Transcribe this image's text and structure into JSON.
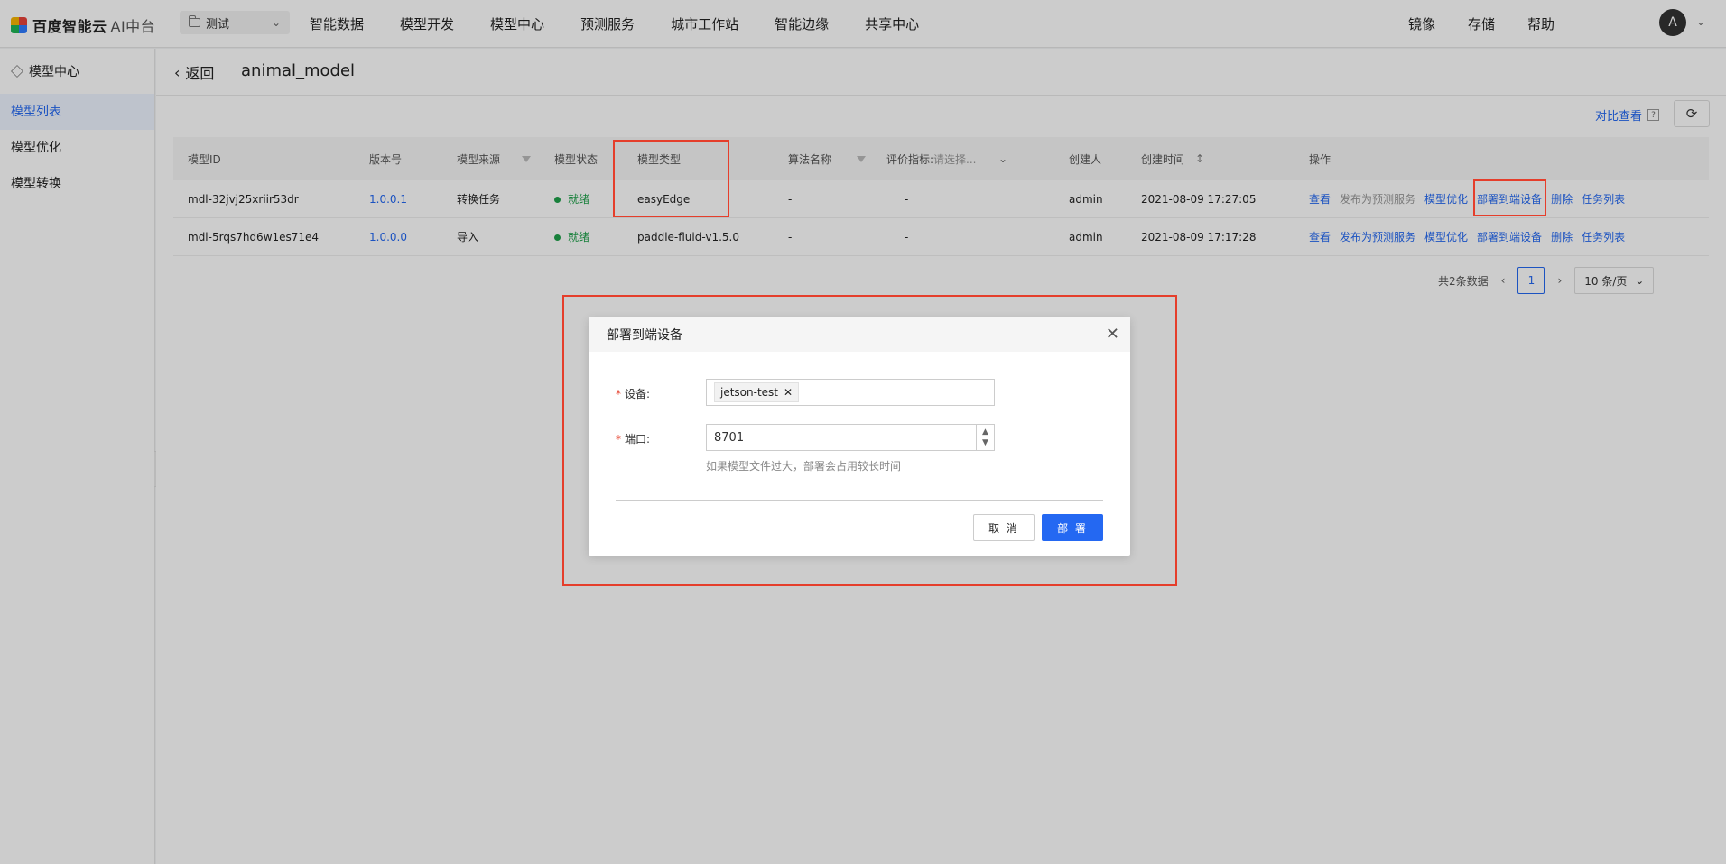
{
  "topbar": {
    "logo_text": "百度智能云",
    "logo_ai": "AI中台",
    "project": "测试",
    "nav": [
      "智能数据",
      "模型开发",
      "模型中心",
      "预测服务",
      "城市工作站",
      "智能边缘",
      "共享中心"
    ],
    "right_nav": [
      "镜像",
      "存储",
      "帮助"
    ],
    "avatar": "A"
  },
  "sidebar": {
    "title": "模型中心",
    "items": [
      "模型列表",
      "模型优化",
      "模型转换"
    ]
  },
  "header": {
    "back": "返回",
    "model_name": "animal_model",
    "compare": "对比查看",
    "help": "?"
  },
  "table": {
    "columns": [
      "模型ID",
      "版本号",
      "模型来源",
      "模型状态",
      "模型类型",
      "算法名称",
      "评价指标:",
      "请选择...",
      "创建人",
      "创建时间",
      "操作"
    ],
    "rows": [
      {
        "id": "mdl-32jvj25xriir53dr",
        "version": "1.0.0.1",
        "source": "转换任务",
        "status": "就绪",
        "type": "easyEdge",
        "algo": "-",
        "metric": "-",
        "creator": "admin",
        "created": "2021-08-09 17:27:05"
      },
      {
        "id": "mdl-5rqs7hd6w1es71e4",
        "version": "1.0.0.0",
        "source": "导入",
        "status": "就绪",
        "type": "paddle-fluid-v1.5.0",
        "algo": "-",
        "metric": "-",
        "creator": "admin",
        "created": "2021-08-09 17:17:28"
      }
    ],
    "ops": [
      "查看",
      "发布为预测服务",
      "模型优化",
      "部署到端设备",
      "删除",
      "任务列表"
    ]
  },
  "pager": {
    "total": "共2条数据",
    "page": "1",
    "page_size": "10 条/页"
  },
  "dialog": {
    "title": "部署到端设备",
    "device_label": "设备",
    "device_tag": "jetson-test",
    "port_label": "端口",
    "colon": ":",
    "port_value": "8701",
    "hint": "如果模型文件过大，部署会占用较长时间",
    "cancel": "取 消",
    "ok": "部 署"
  },
  "colors": {
    "accent": "#2468f2",
    "highlight": "#e53e2b",
    "ok": "#1fa14a"
  }
}
